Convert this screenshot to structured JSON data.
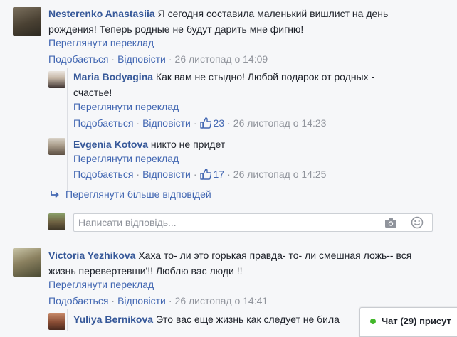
{
  "comments": [
    {
      "author": "Nesterenko Anastasiia",
      "text_line1": "Я сегодня составила маленький вишлист на день",
      "text_line2": "рождения! Теперь родные не будут дарить мне фигню!",
      "translate": "Переглянути переклад",
      "like": "Подобається",
      "reply": "Відповісти",
      "time": "26 листопад о 14:09"
    },
    {
      "author": "Victoria Yezhikova",
      "text_line1": "Хаха то- ли это горькая правда- то- ли смешная ложь-- вся",
      "text_line2": "жизнь перевертевши'!! Люблю вас люди !!",
      "translate": "Переглянути переклад",
      "like": "Подобається",
      "reply": "Відповісти",
      "time": "26 листопад о 14:41"
    }
  ],
  "replies": [
    {
      "author": "Maria Bodyagina",
      "text_line1": "Как вам не стыдно! Любой подарок от родных -",
      "text_line2": "счастье!",
      "translate": "Переглянути переклад",
      "like": "Подобається",
      "reply": "Відповісти",
      "likes_count": "23",
      "time": "26 листопад о 14:23"
    },
    {
      "author": "Evgenia Kotova",
      "text_line1": "никто не придет",
      "translate": "Переглянути переклад",
      "like": "Подобається",
      "reply": "Відповісти",
      "likes_count": "17",
      "time": "26 листопад о 14:25"
    },
    {
      "author": "Yuliya Bernikova",
      "text_line1": "Это вас еще жизнь как следует не била"
    }
  ],
  "more_replies": "Переглянути більше відповідей",
  "reply_box": {
    "placeholder": "Написати відповідь..."
  },
  "chat": {
    "label": "Чат (29) присут"
  },
  "icons": {
    "like": "thumbs-up-icon",
    "camera": "camera-icon",
    "emoji": "smiley-icon",
    "more": "reply-arrow-icon",
    "online": "online-dot-icon"
  },
  "colors": {
    "name": "#365899",
    "link": "#4267b2",
    "meta": "#90949c",
    "online": "#42b72a"
  }
}
